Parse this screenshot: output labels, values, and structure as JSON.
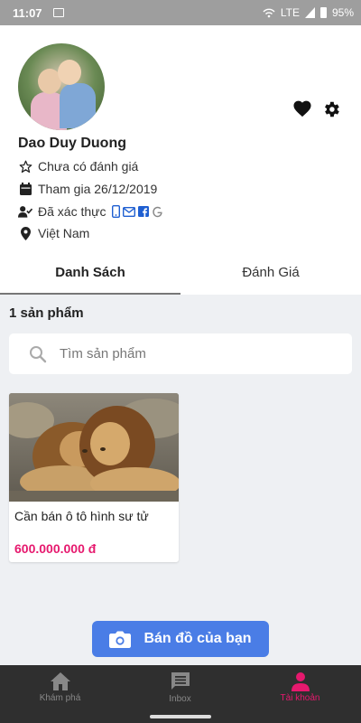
{
  "status_bar": {
    "time": "11:07",
    "network": "LTE",
    "battery": "95%"
  },
  "profile": {
    "name": "Dao Duy Duong",
    "rating_text": "Chưa có đánh giá",
    "joined_text": "Tham gia 26/12/2019",
    "verified_text": "Đã xác thực",
    "location": "Việt Nam",
    "verified_icons": [
      "phone-icon",
      "email-icon",
      "facebook-icon",
      "google-icon"
    ]
  },
  "tabs": [
    {
      "label": "Danh Sách",
      "active": true
    },
    {
      "label": "Đánh Giá",
      "active": false
    }
  ],
  "listing": {
    "count_label": "1 sản phẩm",
    "search_placeholder": "Tìm sản phẩm",
    "products": [
      {
        "title": "Cần bán ô tô hình sư tử",
        "price": "600.000.000 đ"
      }
    ]
  },
  "sell_button": {
    "label": "Bán đồ của bạn"
  },
  "bottom_nav": [
    {
      "label": "Khám phá",
      "icon": "home-icon",
      "active": false
    },
    {
      "label": "Inbox",
      "icon": "chat-icon",
      "active": false
    },
    {
      "label": "Tài khoản",
      "icon": "person-icon",
      "active": true
    }
  ],
  "colors": {
    "accent": "#e6196e",
    "primary_button": "#4a7de6",
    "nav_bg": "#2f2f2f"
  }
}
